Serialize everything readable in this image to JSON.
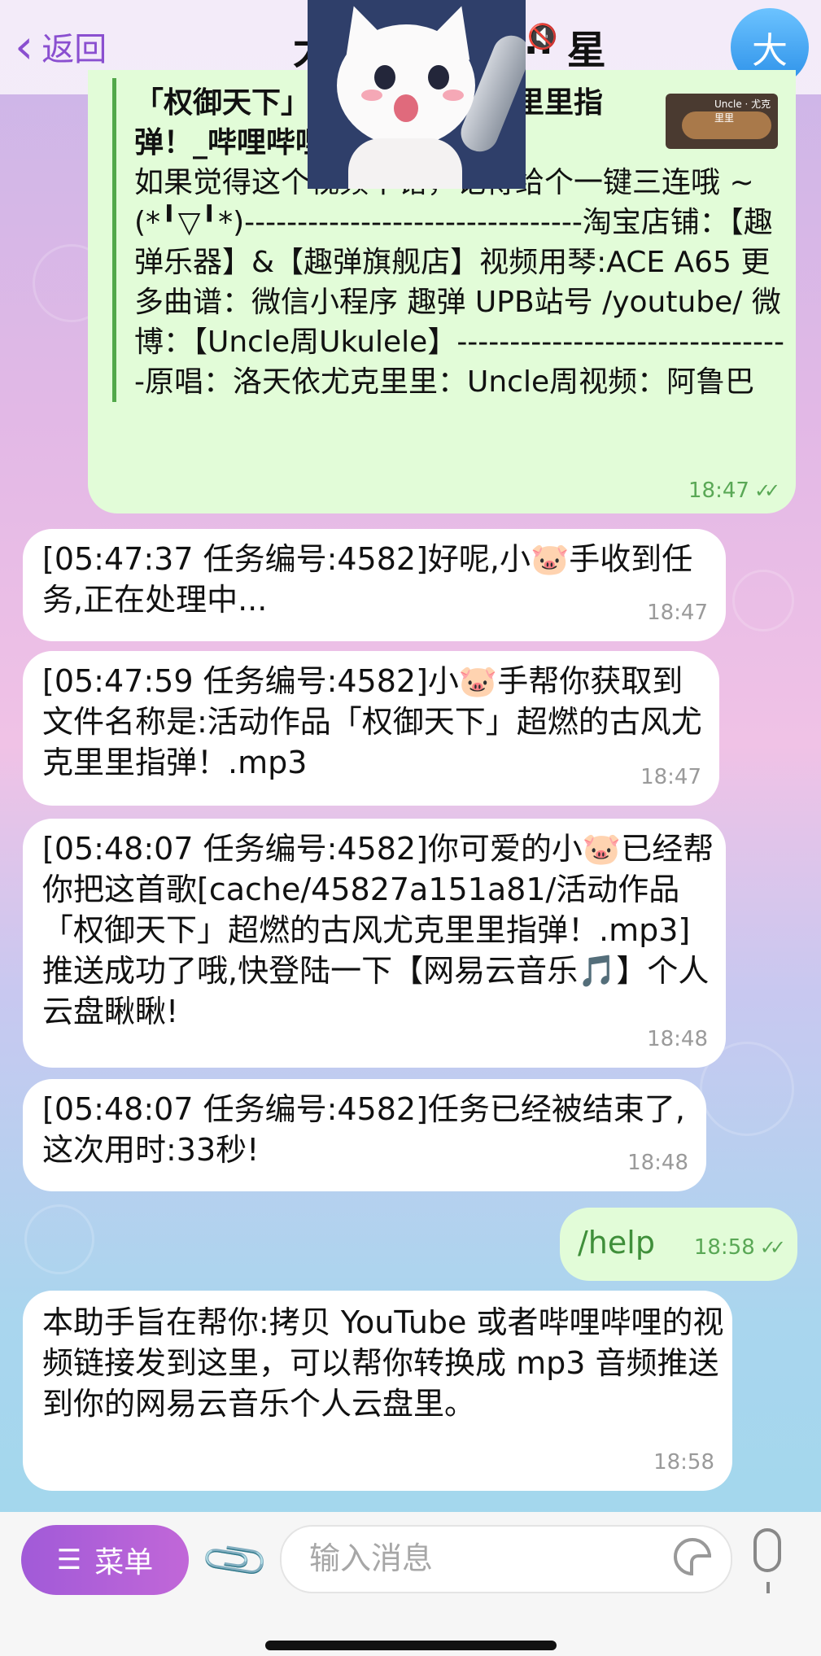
{
  "header": {
    "back_label": "返回",
    "chat_title": "大 ·············· 星",
    "avatar_letter": "大"
  },
  "preview": {
    "title": "「权御天下」超燃的古风尤克里里指弹！_哔哩哔哩",
    "body": "如果觉得这个视频不错，记得给个一键三连哦 ~(*╹▽╹*)--------------------------------淘宝店铺：【趣弹乐器】&【趣弹旗舰店】视频用琴:ACE A65 更多曲谱：微信小程序 趣弹 UPB站号 /youtube/ 微博：【Uncle周Ukulele】--------------------------------原唱：洛天依尤克里里：Uncle周视频：阿鲁巴",
    "time": "18:47",
    "thumb_label": "Uncle · 尤克里里"
  },
  "messages": [
    {
      "text": "[05:47:37 任务编号:4582]好呢,小🐷手收到任务,正在处理中...",
      "time": "18:47"
    },
    {
      "text": "[05:47:59 任务编号:4582]小🐷手帮你获取到文件名称是:活动作品「权御天下」超燃的古风尤克里里指弹！.mp3",
      "time": "18:47"
    },
    {
      "text": "[05:48:07 任务编号:4582]你可爱的小🐷已经帮你把这首歌[cache/45827a151a81/活动作品「权御天下」超燃的古风尤克里里指弹！.mp3]推送成功了哦,快登陆一下【网易云音乐🎵】个人云盘瞅瞅!",
      "time": "18:48"
    },
    {
      "text": "[05:48:07 任务编号:4582]任务已经被结束了,这次用时:33秒!",
      "time": "18:48"
    },
    {
      "text": "/help",
      "time": "18:58"
    },
    {
      "text": "本助手旨在帮你:拷贝 YouTube 或者哔哩哔哩的视频链接发到这里，可以帮你转换成 mp3 音频推送到你的网易云音乐个人云盘里。",
      "time": "18:58"
    }
  ],
  "composer": {
    "menu_label": "菜单",
    "placeholder": "输入消息"
  },
  "icons": {
    "ticks": "✓✓",
    "menu": "☰",
    "attach": "📎"
  }
}
